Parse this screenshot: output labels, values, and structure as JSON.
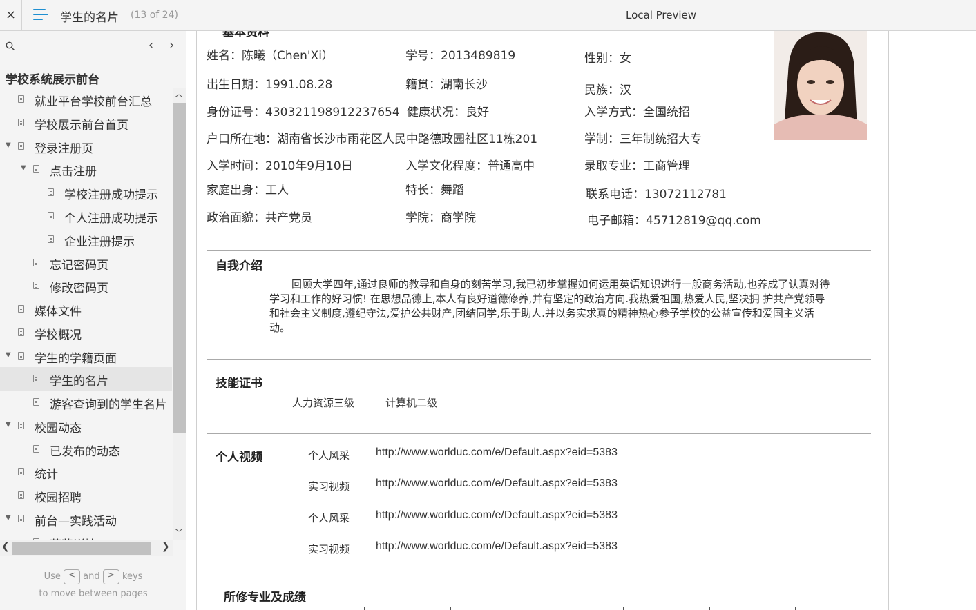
{
  "topbar": {
    "close": "×",
    "page_name": "学生的名片",
    "page_count": "(13 of 24)",
    "window_title": "Local Preview"
  },
  "sidebar": {
    "heading": "学校系统展示前台",
    "nav_prev": "‹",
    "nav_next": "›",
    "items": [
      {
        "label": "就业平台学校前台汇总",
        "level": 1,
        "expanded": null
      },
      {
        "label": "学校展示前台首页",
        "level": 1,
        "expanded": null
      },
      {
        "label": "登录注册页",
        "level": 1,
        "expanded": true
      },
      {
        "label": "点击注册",
        "level": 2,
        "expanded": true
      },
      {
        "label": "学校注册成功提示",
        "level": 3,
        "expanded": null
      },
      {
        "label": "个人注册成功提示",
        "level": 3,
        "expanded": null
      },
      {
        "label": "企业注册提示",
        "level": 3,
        "expanded": null
      },
      {
        "label": "忘记密码页",
        "level": 2,
        "expanded": null
      },
      {
        "label": "修改密码页",
        "level": 2,
        "expanded": null
      },
      {
        "label": "媒体文件",
        "level": 1,
        "expanded": null
      },
      {
        "label": "学校概况",
        "level": 1,
        "expanded": null
      },
      {
        "label": "学生的学籍页面",
        "level": 1,
        "expanded": true
      },
      {
        "label": "学生的名片",
        "level": 2,
        "expanded": null,
        "selected": true
      },
      {
        "label": "游客查询到的学生名片",
        "level": 2,
        "expanded": null
      },
      {
        "label": "校园动态",
        "level": 1,
        "expanded": true
      },
      {
        "label": "已发布的动态",
        "level": 2,
        "expanded": null
      },
      {
        "label": "统计",
        "level": 1,
        "expanded": null
      },
      {
        "label": "校园招聘",
        "level": 1,
        "expanded": null
      },
      {
        "label": "前台—实践活动",
        "level": 1,
        "expanded": true
      },
      {
        "label": "获奖详情",
        "level": 2,
        "expanded": null
      }
    ],
    "hint": {
      "use": "Use",
      "prev_key": "<",
      "and": "and",
      "next_key": ">",
      "keys": "keys",
      "line2": "to move between pages"
    }
  },
  "profile": {
    "section_cut": "基本资料",
    "name": "姓名：陈曦（Chen'Xi）",
    "student_no": "学号：2013489819",
    "gender": "性别：女",
    "birth": "出生日期：1991.08.28",
    "origin": "籍贯：湖南长沙",
    "ethnicity": "民族：汉",
    "id_no": "身份证号：430321198912237654",
    "health": "健康状况：良好",
    "admission_method": "入学方式：全国统招",
    "residence": "户口所在地：湖南省长沙市雨花区人民中路德政园社区11栋201",
    "system": "学制：三年制统招大专",
    "admission_date": "入学时间：2010年9月10日",
    "education": "入学文化程度：普通高中",
    "major": "录取专业：工商管理",
    "family": "家庭出身：工人",
    "specialty": "特长：舞蹈",
    "phone": "联系电话：13072112781",
    "political": "政治面貌：共产党员",
    "college": "学院：商学院",
    "email": "电子邮箱：45712819@qq.com"
  },
  "intro": {
    "title": "自我介绍",
    "text": "回顾大学四年,通过良师的教导和自身的刻苦学习,我已初步掌握如何运用英语知识进行一般商务活动,也养成了认真对待学习和工作的好习惯! 在思想品德上,本人有良好道德修养,并有坚定的政治方向.我热爱祖国,热爱人民,坚决拥 护共产党领导和社会主义制度,遵纪守法,爱护公共财产,团结同学,乐于助人.并以务实求真的精神热心参予学校的公益宣传和爱国主义活动。"
  },
  "skills": {
    "title": "技能证书",
    "items": [
      "人力资源三级",
      "计算机二级"
    ]
  },
  "videos": {
    "title": "个人视频",
    "items": [
      {
        "label": "个人风采",
        "url": "http://www.worlduc.com/e/Default.aspx?eid=5383"
      },
      {
        "label": "实习视频",
        "url": "http://www.worlduc.com/e/Default.aspx?eid=5383"
      },
      {
        "label": "个人风采",
        "url": "http://www.worlduc.com/e/Default.aspx?eid=5383"
      },
      {
        "label": "实习视频",
        "url": "http://www.worlduc.com/e/Default.aspx?eid=5383"
      }
    ]
  },
  "courses": {
    "title": "所修专业及成绩"
  },
  "colors": {
    "accent": "#1f8fd1",
    "sidebar_bg": "#f4f4f4",
    "selected_bg": "#e5e5e5"
  }
}
